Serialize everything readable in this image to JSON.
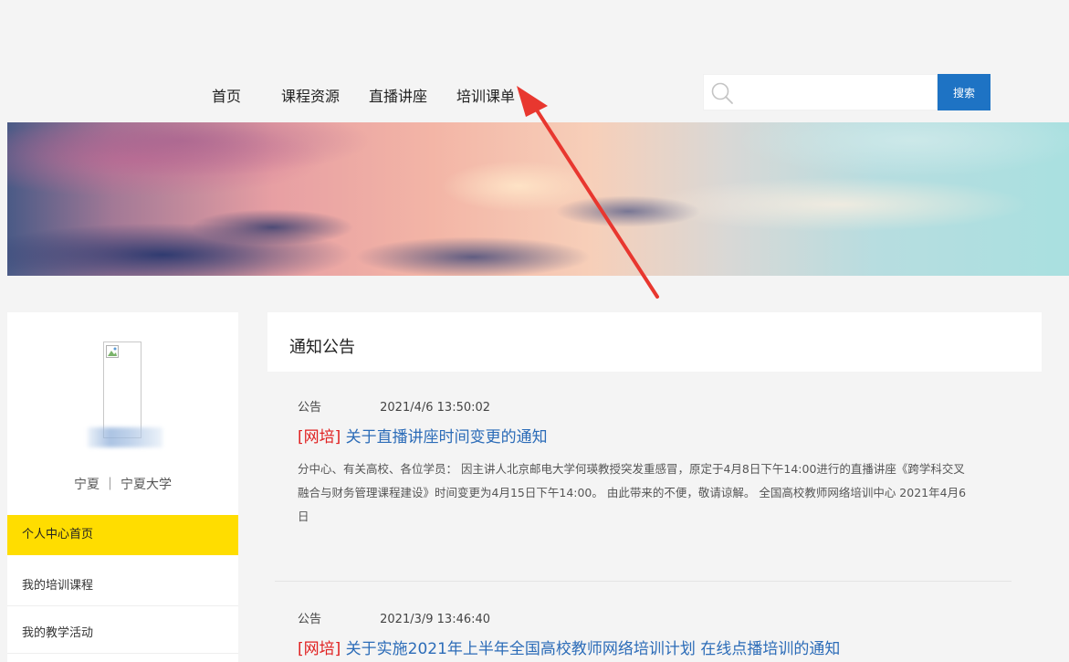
{
  "nav": {
    "items": [
      {
        "label": "首页"
      },
      {
        "label": "课程资源"
      },
      {
        "label": "直播讲座"
      },
      {
        "label": "培训课单"
      }
    ]
  },
  "search": {
    "placeholder": "",
    "button_label": "搜索",
    "button_color": "#1e73c4"
  },
  "sidebar": {
    "user_location": "宁夏 ｜ 宁夏大学",
    "menu": [
      {
        "label": "个人中心首页",
        "active": true
      },
      {
        "label": "我的培训课程",
        "active": false
      },
      {
        "label": "我的教学活动",
        "active": false
      }
    ],
    "active_color": "#ffdd00"
  },
  "main": {
    "title": "通知公告",
    "notices": [
      {
        "type": "公告",
        "date": "2021/4/6 13:50:02",
        "tag": "[网培]",
        "title": "关于直播讲座时间变更的通知",
        "body": "分中心、有关高校、各位学员：    因主讲人北京邮电大学何瑛教授突发重感冒，原定于4月8日下午14:00进行的直播讲座《跨学科交叉融合与财务管理课程建设》时间变更为4月15日下午14:00。 由此带来的不便，敬请谅解。 全国高校教师网络培训中心 2021年4月6日"
      },
      {
        "type": "公告",
        "date": "2021/3/9 13:46:40",
        "tag": "[网培]",
        "title": "关于实施2021年上半年全国高校教师网络培训计划 在线点播培训的通知",
        "body": ""
      }
    ]
  },
  "colors": {
    "link": "#2c6cb8",
    "tag": "#e02020",
    "annotation_arrow": "#e8372f"
  }
}
